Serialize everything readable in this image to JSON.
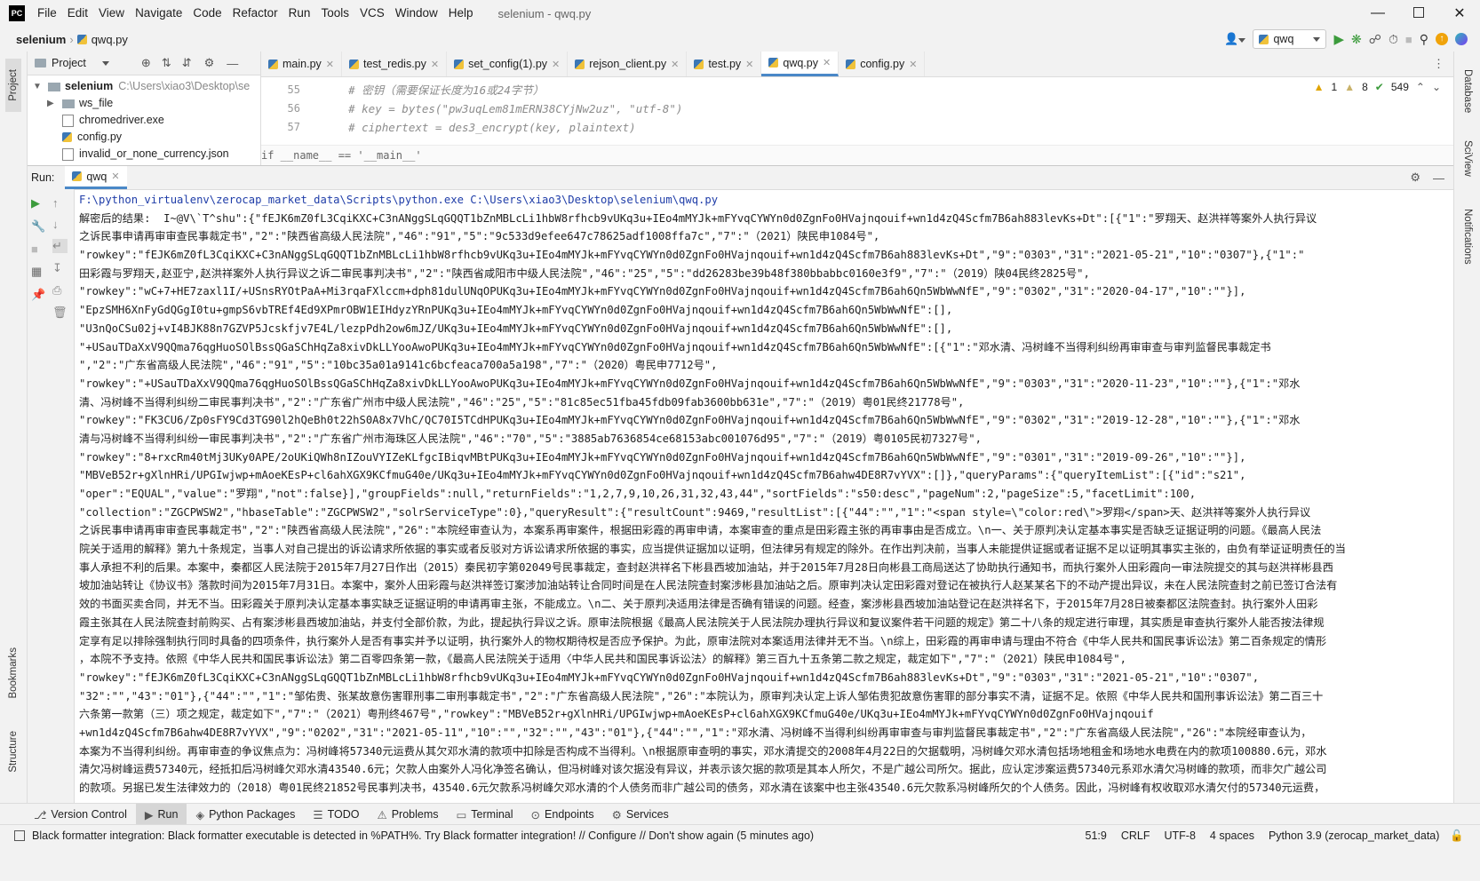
{
  "menu": {
    "logo": "PC",
    "items": [
      "File",
      "Edit",
      "View",
      "Navigate",
      "Code",
      "Refactor",
      "Run",
      "Tools",
      "VCS",
      "Window",
      "Help"
    ],
    "window_title": "selenium - qwq.py"
  },
  "nav": {
    "project": "selenium",
    "file": "qwq.py",
    "run_config": "qwq"
  },
  "left_tools": {
    "project": "Project",
    "bookmarks": "Bookmarks",
    "structure": "Structure"
  },
  "right_tools": {
    "database": "Database",
    "sciview": "SciView",
    "notifications": "Notifications"
  },
  "project_panel": {
    "title": "Project",
    "root_name": "selenium",
    "root_path": "C:\\Users\\xiao3\\Desktop\\se",
    "items": [
      "ws_file",
      "chromedriver.exe",
      "config.py",
      "invalid_or_none_currency.json"
    ]
  },
  "editor": {
    "tabs": [
      "main.py",
      "test_redis.py",
      "set_config(1).py",
      "rejson_client.py",
      "test.py",
      "qwq.py",
      "config.py"
    ],
    "active_tab": "qwq.py",
    "line_numbers": [
      "55",
      "56",
      "57"
    ],
    "lines": [
      "    # 密钥（需要保证长度为16或24字节）",
      "    # key = bytes(\"pw3uqLem81mERN38CYjNw2uz\", \"utf-8\")",
      "    # ciphertext = des3_encrypt(key, plaintext)"
    ],
    "breadcrumb": "if __name__ == '__main__'",
    "inspections": {
      "warnings": "1",
      "weak_warnings": "8",
      "typos": "549"
    }
  },
  "run_panel": {
    "label": "Run:",
    "tab": "qwq",
    "command": "F:\\python_virtualenv\\zerocap_market_data\\Scripts\\python.exe C:\\Users\\xiao3\\Desktop\\selenium\\qwq.py",
    "output_lines": [
      "解密后的结果:  I~@V\\`T^shu\":{\"fEJK6mZ0fL3CqiKXC+C3nANggSLqGQQT1bZnMBLcLi1hbW8rfhcb9vUKq3u+IEo4mMYJk+mFYvqCYWYn0d0ZgnFo0HVajnqouif+wn1d4zQ4Scfm7B6ah883levKs+Dt\":[{\"1\":\"罗翔天、赵洪祥等案外人执行异议",
      "之诉民事申请再审审查民事裁定书\",\"2\":\"陕西省高级人民法院\",\"46\":\"91\",\"5\":\"9c533d9efee647c78625adf1008ffa7c\",\"7\":\"（2021）陕民申1084号\",",
      "\"rowkey\":\"fEJK6mZ0fL3CqiKXC+C3nANggSLqGQQT1bZnMBLcLi1hbW8rfhcb9vUKq3u+IEo4mMYJk+mFYvqCYWYn0d0ZgnFo0HVajnqouif+wn1d4zQ4Scfm7B6ah883levKs+Dt\",\"9\":\"0303\",\"31\":\"2021-05-21\",\"10\":\"0307\"},{\"1\":\"",
      "田彩霞与罗翔天,赵亚宁,赵洪祥案外人执行异议之诉二审民事判决书\",\"2\":\"陕西省咸阳市中级人民法院\",\"46\":\"25\",\"5\":\"dd26283be39b48f380bbabbc0160e3f9\",\"7\":\"（2019）陕04民终2825号\",",
      "\"rowkey\":\"wC+7+HE7zaxl1I/+USnsRYOtPaA+Mi3rqaFXlccm+dph81dulUNqOPUKq3u+IEo4mMYJk+mFYvqCYWYn0d0ZgnFo0HVajnqouif+wn1d4zQ4Scfm7B6ah6Qn5WbWwNfE\",\"9\":\"0302\",\"31\":\"2020-04-17\",\"10\":\"\"}],",
      "\"EpzSMH6XnFyGdQGgI0tu+gmpS6vbTREf4Ed9XPmrOBW1EIHdyzYRnPUKq3u+IEo4mMYJk+mFYvqCYWYn0d0ZgnFo0HVajnqouif+wn1d4zQ4Scfm7B6ah6Qn5WbWwNfE\":[],",
      "\"U3nQoCSu02j+vI4BJK88n7GZVP5Jcskfjv7E4L/lezpPdh2ow6mJZ/UKq3u+IEo4mMYJk+mFYvqCYWYn0d0ZgnFo0HVajnqouif+wn1d4zQ4Scfm7B6ah6Qn5WbWwNfE\":[],",
      "\"+USauTDaXxV9QQma76qgHuoSOlBssQGaSChHqZa8xivDkLLYooAwoPUKq3u+IEo4mMYJk+mFYvqCYWYn0d0ZgnFo0HVajnqouif+wn1d4zQ4Scfm7B6ah6Qn5WbWwNfE\":[{\"1\":\"邓水清、冯树峰不当得利纠纷再审审查与审判监督民事裁定书",
      "\",\"2\":\"广东省高级人民法院\",\"46\":\"91\",\"5\":\"10bc35a01a9141c6bcfeaca700a5a198\",\"7\":\"（2020）粤民申7712号\",",
      "\"rowkey\":\"+USauTDaXxV9QQma76qgHuoSOlBssQGaSChHqZa8xivDkLLYooAwoPUKq3u+IEo4mMYJk+mFYvqCYWYn0d0ZgnFo0HVajnqouif+wn1d4zQ4Scfm7B6ah6Qn5WbWwNfE\",\"9\":\"0303\",\"31\":\"2020-11-23\",\"10\":\"\"},{\"1\":\"邓水",
      "清、冯树峰不当得利纠纷二审民事判决书\",\"2\":\"广东省广州市中级人民法院\",\"46\":\"25\",\"5\":\"81c85ec51fba45fdb09fab3600bb631e\",\"7\":\"（2019）粤01民终21778号\",",
      "\"rowkey\":\"FK3CU6/Zp0sFY9Cd3TG90l2hQeBh0t22hS0A8x7VhC/QC70I5TCdHPUKq3u+IEo4mMYJk+mFYvqCYWYn0d0ZgnFo0HVajnqouif+wn1d4zQ4Scfm7B6ah6Qn5WbWwNfE\",\"9\":\"0302\",\"31\":\"2019-12-28\",\"10\":\"\"},{\"1\":\"邓水",
      "清与冯树峰不当得利纠纷一审民事判决书\",\"2\":\"广东省广州市海珠区人民法院\",\"46\":\"70\",\"5\":\"3885ab7636854ce68153abc001076d95\",\"7\":\"（2019）粤0105民初7327号\",",
      "\"rowkey\":\"8+rxcRm40tMj3UKy0APE/2oUKiQWh8nIZouVYIZeKLfgcIBiqvMBtPUKq3u+IEo4mMYJk+mFYvqCYWYn0d0ZgnFo0HVajnqouif+wn1d4zQ4Scfm7B6ah6Qn5WbWwNfE\",\"9\":\"0301\",\"31\":\"2019-09-26\",\"10\":\"\"}],",
      "\"MBVeB52r+gXlnHRi/UPGIwjwp+mAoeKEsP+cl6ahXGX9KCfmuG40e/UKq3u+IEo4mMYJk+mFYvqCYWYn0d0ZgnFo0HVajnqouif+wn1d4zQ4Scfm7B6ahw4DE8R7vYVX\":[]},\"queryParams\":{\"queryItemList\":[{\"id\":\"s21\",",
      "\"oper\":\"EQUAL\",\"value\":\"罗翔\",\"not\":false}],\"groupFields\":null,\"returnFields\":\"1,2,7,9,10,26,31,32,43,44\",\"sortFields\":\"s50:desc\",\"pageNum\":2,\"pageSize\":5,\"facetLimit\":100,",
      "\"collection\":\"ZGCPWSW2\",\"hbaseTable\":\"ZGCPWSW2\",\"solrServiceType\":0},\"queryResult\":{\"resultCount\":9469,\"resultList\":[{\"44\":\"\",\"1\":\"<span style=\\\"color:red\\\">罗翔</span>天、赵洪祥等案外人执行异议",
      "之诉民事申请再审审查民事裁定书\",\"2\":\"陕西省高级人民法院\",\"26\":\"本院经审查认为，本案系再审案件，根据田彩霞的再审申请，本案审查的重点是田彩霞主张的再审事由是否成立。\\n一、关于原判决认定基本事实是否缺乏证据证明的问题。《最高人民法",
      "院关于适用的解释》第九十条规定，当事人对自己提出的诉讼请求所依据的事实或者反驳对方诉讼请求所依据的事实，应当提供证据加以证明，但法律另有规定的除外。在作出判决前，当事人未能提供证据或者证据不足以证明其事实主张的，由负有举证证明责任的当",
      "事人承担不利的后果。本案中，秦都区人民法院于2015年7月27日作出（2015）秦民初字第02049号民事裁定，查封赵洪祥名下彬县西坡加油站，并于2015年7月28日向彬县工商局送达了协助执行通知书，而执行案外人田彩霞向一审法院提交的其与赵洪祥彬县西",
      "坡加油站转让《协议书》落款时间为2015年7月31日。本案中，案外人田彩霞与赵洪祥签订案涉加油站转让合同时间是在人民法院查封案涉彬县加油站之后。原审判决认定田彩霞对登记在被执行人赵某某名下的不动产提出异议，未在人民法院查封之前已签订合法有",
      "效的书面买卖合同，并无不当。田彩霞关于原判决认定基本事实缺乏证据证明的申请再审主张，不能成立。\\n二、关于原判决适用法律是否确有错误的问题。经查，案涉彬县西坡加油站登记在赵洪祥名下，于2015年7月28日被秦都区法院查封。执行案外人田彩",
      "霞主张其在人民法院查封前购买、占有案涉彬县西坡加油站，并支付全部价款，为此，提起执行异议之诉。原审法院根据《最高人民法院关于人民法院办理执行异议和复议案件若干问题的规定》第二十八条的规定进行审理，其实质是审查执行案外人能否按法律规",
      "定享有足以排除强制执行同时具备的四项条件，执行案外人是否有事实并予以证明，执行案外人的物权期待权是否应予保护。为此，原审法院对本案适用法律并无不当。\\n综上，田彩霞的再审申请与理由不符合《中华人民共和国民事诉讼法》第二百条规定的情形",
      "，本院不予支持。依照《中华人民共和国民事诉讼法》第二百零四条第一款，《最高人民法院关于适用〈中华人民共和国民事诉讼法〉的解释》第三百九十五条第二款之规定，裁定如下\",\"7\":\"（2021）陕民申1084号\",",
      "\"rowkey\":\"fEJK6mZ0fL3CqiKXC+C3nANggSLqGQQT1bZnMBLcLi1hbW8rfhcb9vUKq3u+IEo4mMYJk+mFYvqCYWYn0d0ZgnFo0HVajnqouif+wn1d4zQ4Scfm7B6ah883levKs+Dt\",\"9\":\"0303\",\"31\":\"2021-05-21\",\"10\":\"0307\",",
      "\"32\":\"\",\"43\":\"01\"},{\"44\":\"\",\"1\":\"邹佑贵、张某故意伤害罪刑事二审刑事裁定书\",\"2\":\"广东省高级人民法院\",\"26\":\"本院认为，原审判决认定上诉人邹佑贵犯故意伤害罪的部分事实不清，证据不足。依照《中华人民共和国刑事诉讼法》第二百三十",
      "六条第一款第（三）项之规定，裁定如下\",\"7\":\"（2021）粤刑终467号\",\"rowkey\":\"MBVeB52r+gXlnHRi/UPGIwjwp+mAoeKEsP+cl6ahXGX9KCfmuG40e/UKq3u+IEo4mMYJk+mFYvqCYWYn0d0ZgnFo0HVajnqouif",
      "+wn1d4zQ4Scfm7B6ahw4DE8R7vYVX\",\"9\":\"0202\",\"31\":\"2021-05-11\",\"10\":\"\",\"32\":\"\",\"43\":\"01\"},{\"44\":\"\",\"1\":\"邓水清、冯树峰不当得利纠纷再审审查与审判监督民事裁定书\",\"2\":\"广东省高级人民法院\",\"26\":\"本院经审查认为，",
      "本案为不当得利纠纷。再审审查的争议焦点为：冯树峰将57340元运费从其欠邓水清的款项中扣除是否构成不当得利。\\n根据原审查明的事实，邓水清提交的2008年4月22日的欠据载明，冯树峰欠邓水清包括场地租金和场地水电费在内的款项100880.6元，邓水",
      "清欠冯树峰运费57340元，经抵扣后冯树峰欠邓水清43540.6元；欠款人由案外人冯化净签名确认，但冯树峰对该欠据没有异议，并表示该欠据的款项是其本人所欠，不是广越公司所欠。据此，应认定涉案运费57340元系邓水清欠冯树峰的款项，而非欠广越公司",
      "的款项。另据已发生法律效力的（2018）粤01民终21852号民事判决书，43540.6元欠款系冯树峰欠邓水清的个人债务而非广越公司的债务，邓水清在该案中也主张43540.6元欠款系冯树峰所欠的个人债务。因此，冯树峰有权收取邓水清欠付的57340元运费，"
    ]
  },
  "bottom_tools": [
    "Version Control",
    "Run",
    "Python Packages",
    "TODO",
    "Problems",
    "Terminal",
    "Endpoints",
    "Services"
  ],
  "status": {
    "message": "Black formatter integration: Black formatter executable is detected in %PATH%. Try Black formatter integration! // Configure // Don't show again (5 minutes ago)",
    "position": "51:9",
    "line_sep": "CRLF",
    "encoding": "UTF-8",
    "indent": "4 spaces",
    "interpreter": "Python 3.9 (zerocap_market_data)"
  }
}
